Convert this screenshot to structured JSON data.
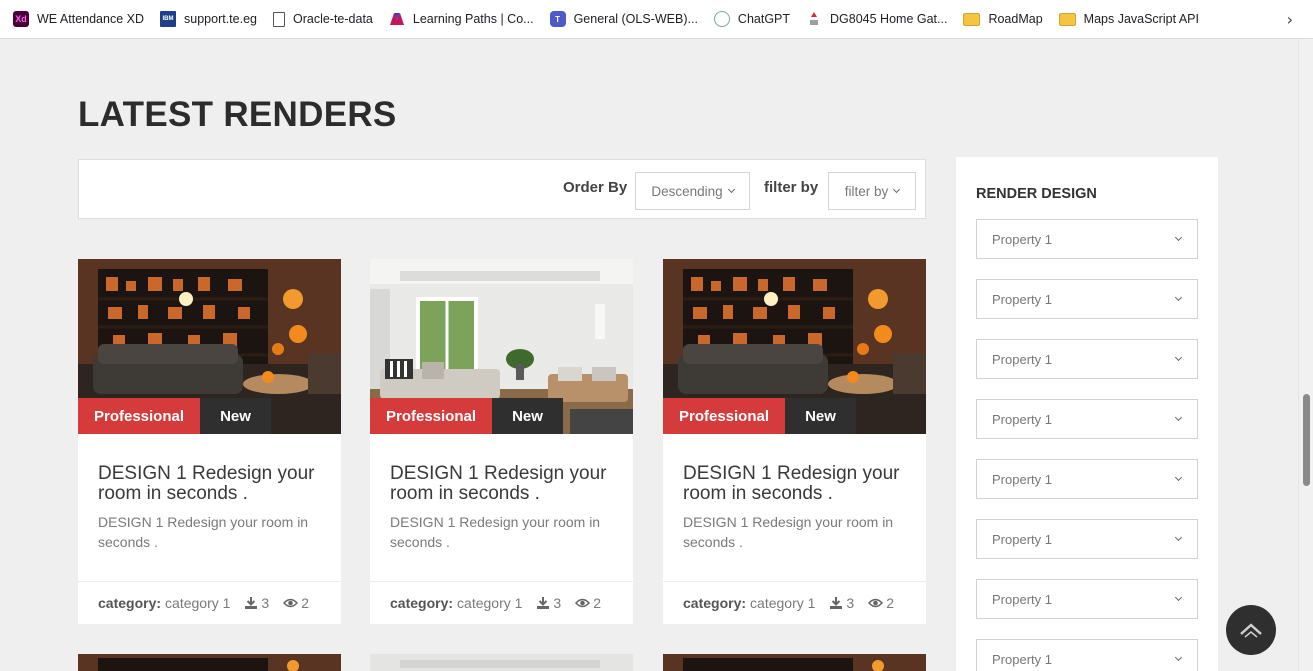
{
  "bookmarks": [
    {
      "label": "WE Attendance XD",
      "icon": "adobe-xd-icon",
      "glyph": "Xd"
    },
    {
      "label": "support.te.eg",
      "icon": "ibm-icon",
      "glyph": "IBM"
    },
    {
      "label": "Oracle-te-data",
      "icon": "document-icon",
      "glyph": ""
    },
    {
      "label": "Learning Paths | Co...",
      "icon": "learning-paths-icon",
      "glyph": ""
    },
    {
      "label": "General (OLS-WEB)...",
      "icon": "teams-icon",
      "glyph": "T"
    },
    {
      "label": "ChatGPT",
      "icon": "chatgpt-icon",
      "glyph": ""
    },
    {
      "label": "DG8045 Home Gat...",
      "icon": "router-icon",
      "glyph": ""
    },
    {
      "label": "RoadMap",
      "icon": "folder-icon",
      "glyph": ""
    },
    {
      "label": "Maps JavaScript API",
      "icon": "folder-icon",
      "glyph": ""
    }
  ],
  "page_title": "LATEST RENDERS",
  "filters": {
    "order_by_label": "Order By",
    "order_by_value": "Descending",
    "filter_by_label": "filter by",
    "filter_by_value": "filter by"
  },
  "cards": [
    {
      "image": "halloween-living-room",
      "badge_primary": "Professional",
      "badge_secondary": "New",
      "title": "DESIGN 1 Redesign your room in seconds .",
      "description": "DESIGN 1 Redesign your room in seconds .",
      "category_label": "category:",
      "category_value": "category 1",
      "downloads": "3",
      "views": "2"
    },
    {
      "image": "white-living-room",
      "badge_primary": "Professional",
      "badge_secondary": "New",
      "title": "DESIGN 1 Redesign your room in seconds .",
      "description": "DESIGN 1 Redesign your room in seconds .",
      "category_label": "category:",
      "category_value": "category 1",
      "downloads": "3",
      "views": "2"
    },
    {
      "image": "halloween-living-room",
      "badge_primary": "Professional",
      "badge_secondary": "New",
      "title": "DESIGN 1 Redesign your room in seconds .",
      "description": "DESIGN 1 Redesign your room in seconds .",
      "category_label": "category:",
      "category_value": "category 1",
      "downloads": "3",
      "views": "2"
    }
  ],
  "sidebar": {
    "title": "RENDER DESIGN",
    "properties": [
      "Property 1",
      "Property 1",
      "Property 1",
      "Property 1",
      "Property 1",
      "Property 1",
      "Property 1",
      "Property 1"
    ]
  },
  "colors": {
    "accent_red": "#d63b3b",
    "badge_dark": "#2f2f2f",
    "page_bg": "#efefef"
  }
}
